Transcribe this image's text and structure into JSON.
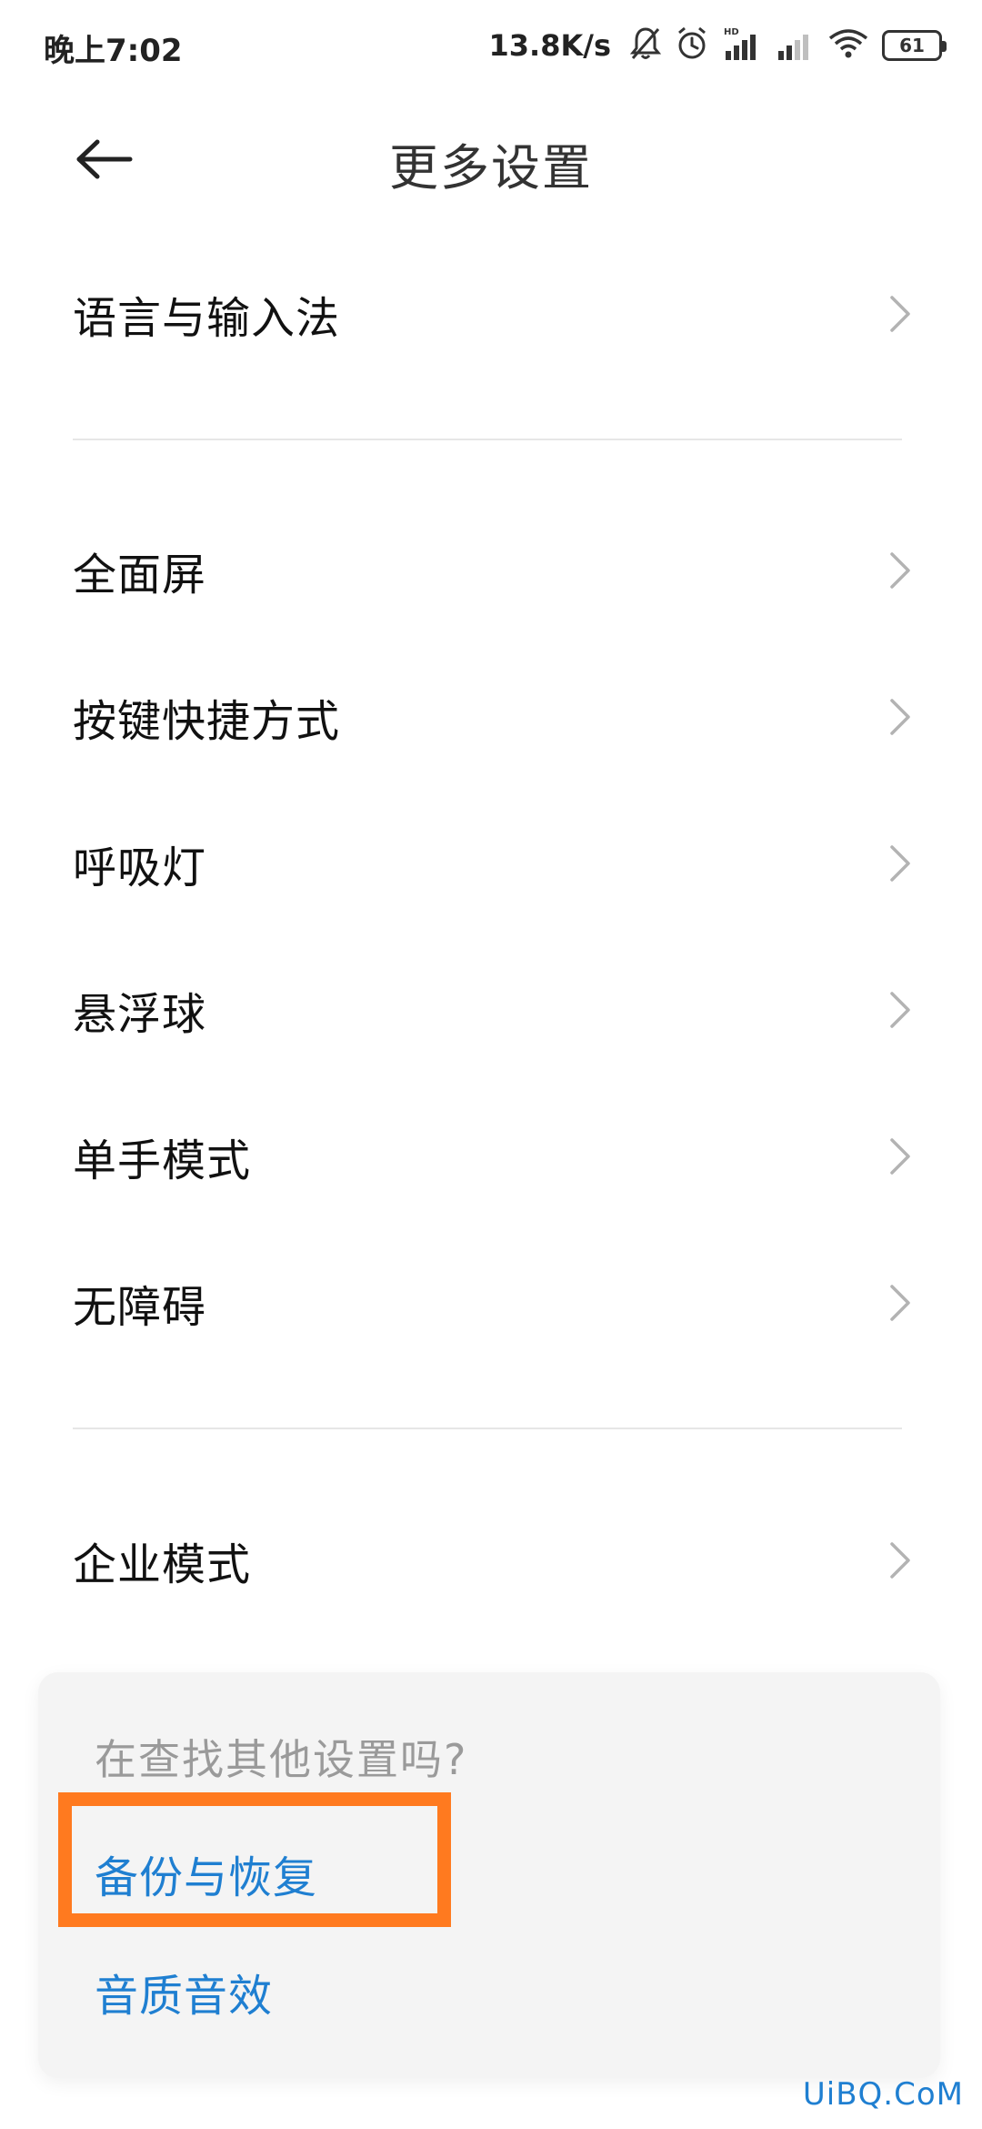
{
  "status_bar": {
    "time": "晚上7:02",
    "network_speed": "13.8K/s",
    "battery": "61",
    "icons": [
      "bell-muted-icon",
      "alarm-icon",
      "hd-signal-icon",
      "signal-icon",
      "wifi-icon",
      "battery-icon"
    ]
  },
  "header": {
    "back_icon": "arrow-left-icon",
    "title": "更多设置"
  },
  "settings": {
    "items": [
      {
        "label": "语言与输入法"
      },
      {
        "label": "全面屏"
      },
      {
        "label": "按键快捷方式"
      },
      {
        "label": "呼吸灯"
      },
      {
        "label": "悬浮球"
      },
      {
        "label": "单手模式"
      },
      {
        "label": "无障碍"
      },
      {
        "label": "企业模式"
      }
    ]
  },
  "suggestions": {
    "title": "在查找其他设置吗?",
    "items": [
      {
        "label": "备份与恢复"
      },
      {
        "label": "音质音效"
      }
    ],
    "highlight_color": "#ff7a1f",
    "link_color": "#1f7fd1"
  },
  "watermark": "UiBQ.CoM"
}
